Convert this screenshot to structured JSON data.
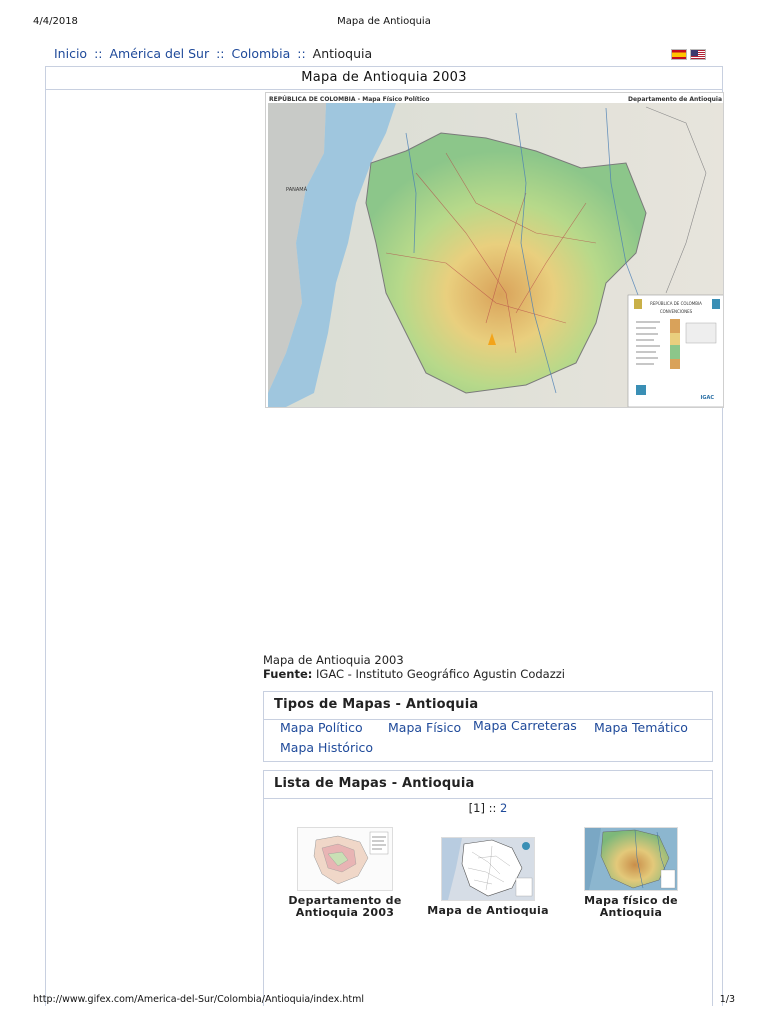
{
  "print_header": {
    "date": "4/4/2018",
    "title": "Mapa de Antioquia"
  },
  "breadcrumb": {
    "items": [
      "Inicio",
      "América del Sur",
      "Colombia"
    ],
    "separator": "::",
    "current": "Antioquia"
  },
  "language_flags": [
    "spain-flag-icon",
    "usa-flag-icon"
  ],
  "main": {
    "title": "Mapa de Antioquia 2003",
    "map_header_left": "REPÚBLICA DE COLOMBIA - Mapa Físico Político",
    "map_header_right": "Departamento de Antioquia",
    "map_legend_title": "REPÚBLICA DE COLOMBIA",
    "map_legend_sub": "CONVENCIONES",
    "map_label_panama": "PANAMÁ",
    "map_legend_logo": "IGAC",
    "caption_title": "Mapa de Antioquia 2003",
    "source_label": "Fuente:",
    "source_value": "IGAC - Instituto Geográfico Agustin Codazzi"
  },
  "types_panel": {
    "title": "Tipos de Mapas - Antioquia",
    "links": [
      "Mapa Político",
      "Mapa Físico",
      "Mapa Carreteras",
      "Mapa Temático",
      "Mapa Histórico"
    ]
  },
  "list_panel": {
    "title": "Lista de Mapas - Antioquia",
    "pager_current": "[1]",
    "pager_sep": "::",
    "pager_next": "2",
    "thumbnails": [
      {
        "label_line1": "Departamento de",
        "label_line2": "Antioquia 2003"
      },
      {
        "label_line1": "Mapa de Antioquia",
        "label_line2": ""
      },
      {
        "label_line1": "Mapa físico de",
        "label_line2": "Antioquia"
      }
    ]
  },
  "print_footer": {
    "url": "http://www.gifex.com/America-del-Sur/Colombia/Antioquia/index.html",
    "page": "1/3"
  },
  "colors": {
    "link": "#1f4a9a",
    "border": "#c8d0e0",
    "map_sea": "#9fc6de",
    "map_lowland": "#8fc98a",
    "map_highland": "#e8b86a"
  }
}
